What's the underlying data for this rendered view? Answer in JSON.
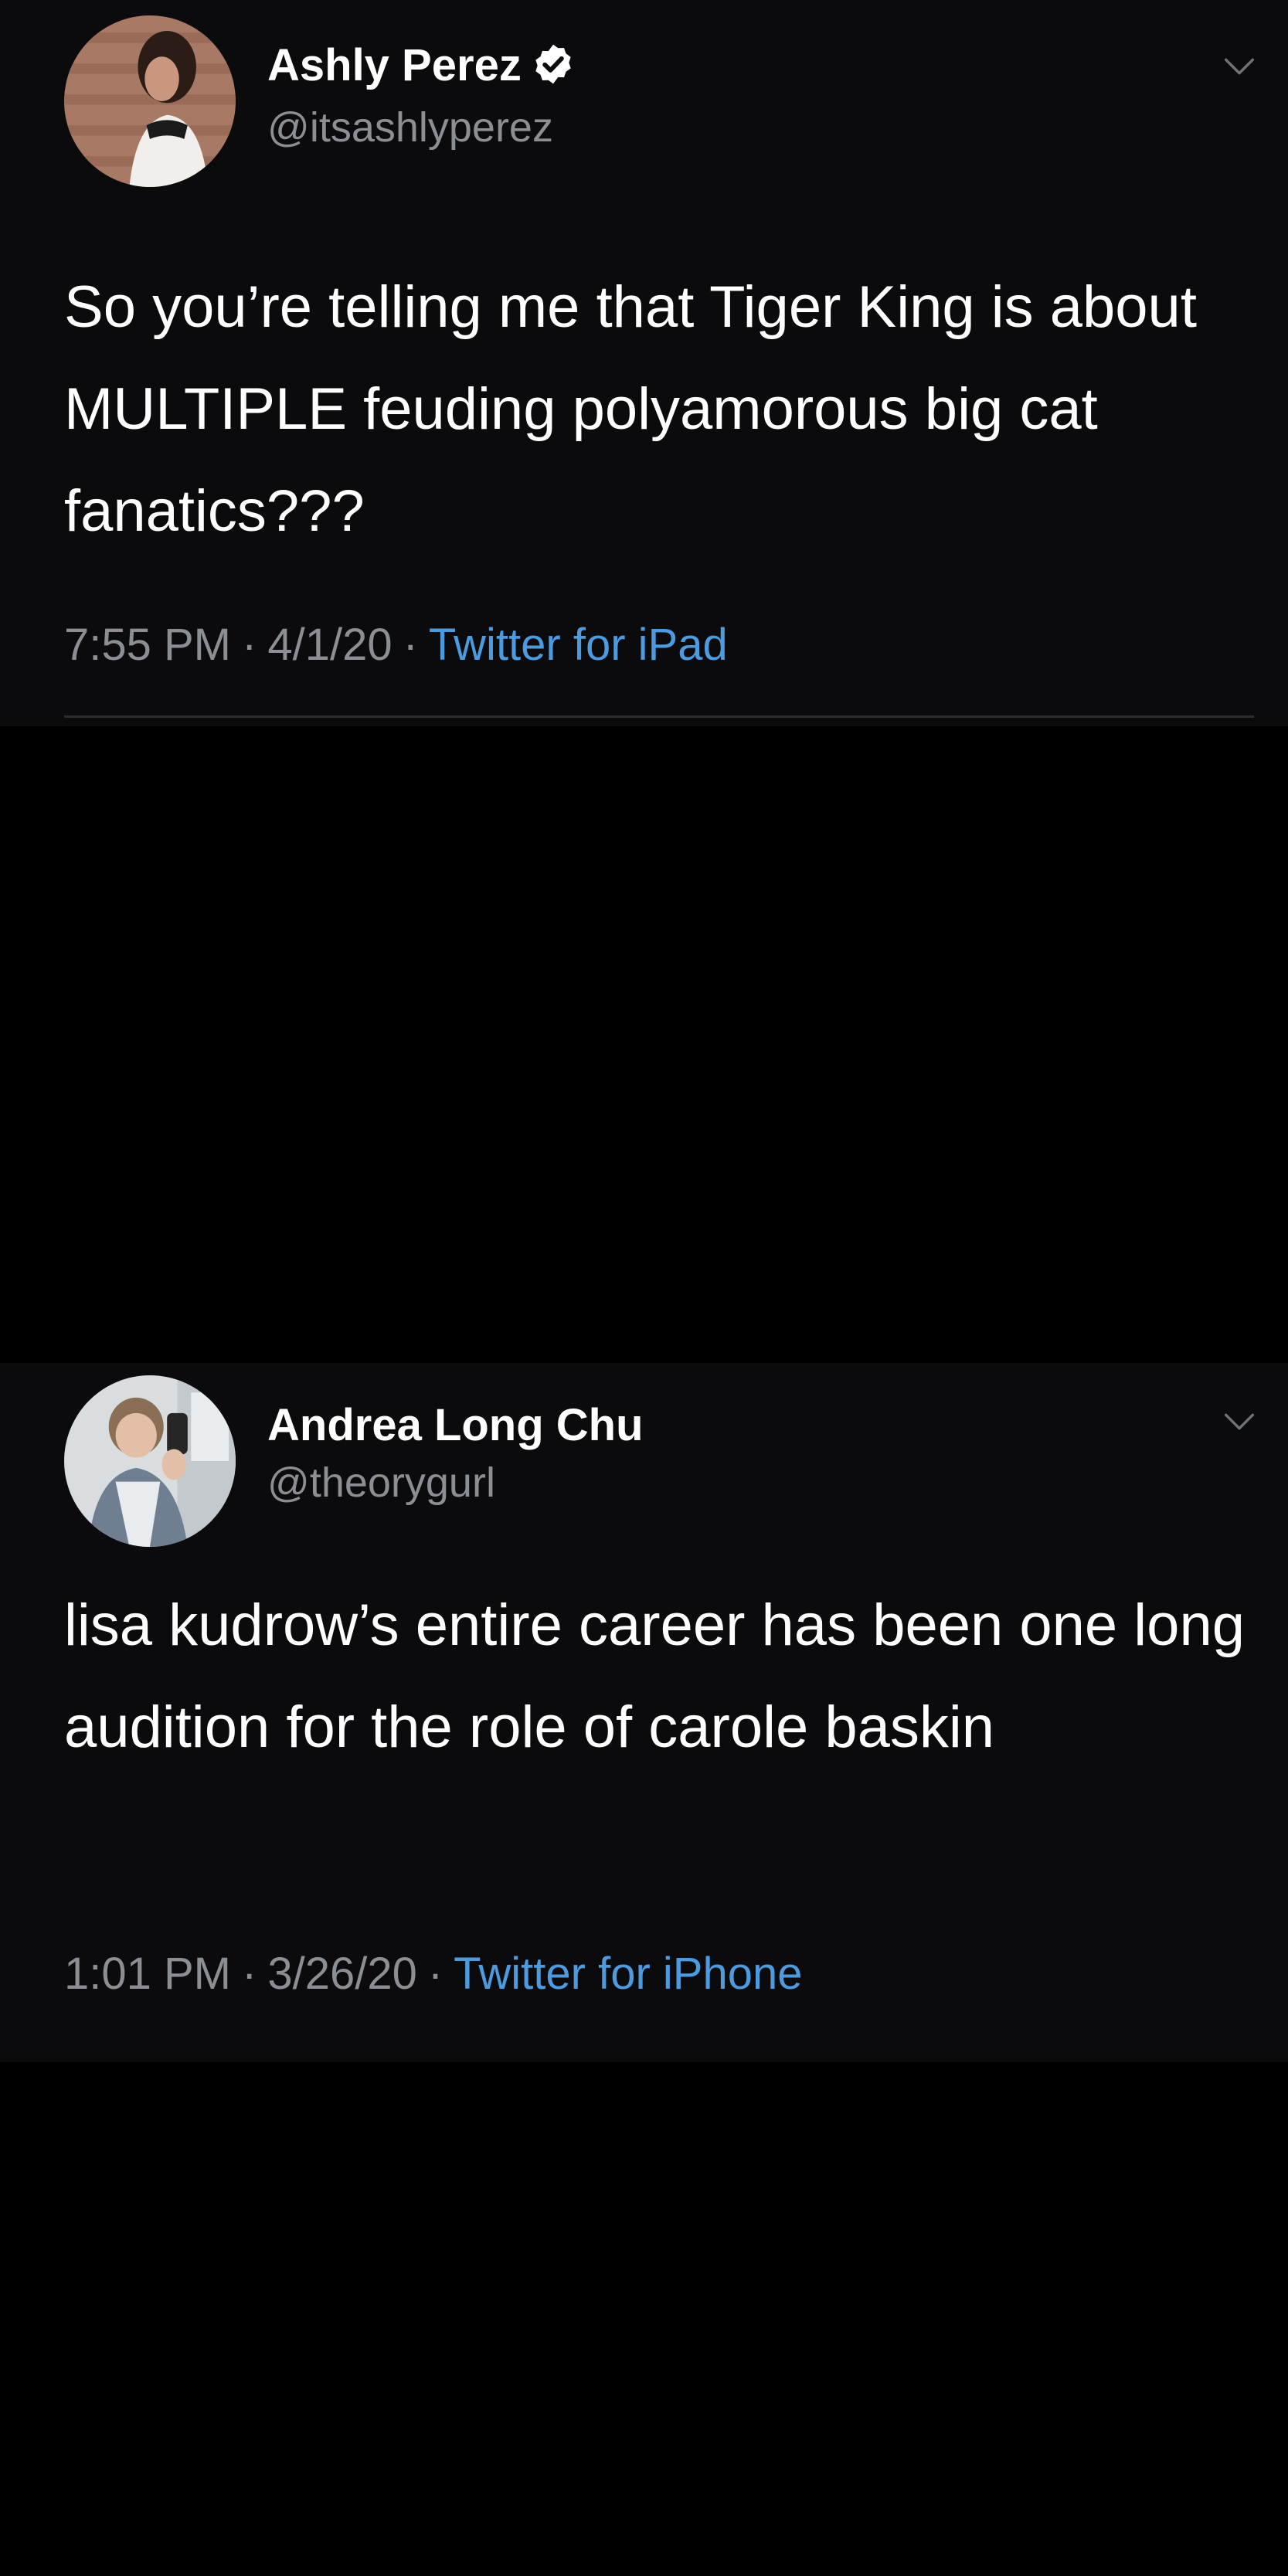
{
  "tweets": [
    {
      "author": {
        "display_name": "Ashly Perez",
        "handle": "@itsashlyperez",
        "verified": true
      },
      "text": "So you’re telling me that Tiger King is about MULTIPLE feuding polyamorous big cat fanatics???",
      "time": "7:55 PM",
      "date": "4/1/20",
      "source": "Twitter for iPad",
      "separator": "·"
    },
    {
      "author": {
        "display_name": "Andrea Long Chu",
        "handle": "@theorygurl",
        "verified": false
      },
      "text": "lisa kudrow’s entire career has been one long audition for the role of carole baskin",
      "time": "1:01 PM",
      "date": "3/26/20",
      "source": "Twitter for iPhone",
      "separator": "·"
    }
  ],
  "colors": {
    "background": "#000000",
    "tweet_background": "#0b0b0d",
    "primary_text": "#ffffff",
    "secondary_text": "#8b8f94",
    "link": "#4d9bde"
  },
  "icons": {
    "verified": "verified-badge-icon",
    "more": "chevron-down-icon"
  }
}
